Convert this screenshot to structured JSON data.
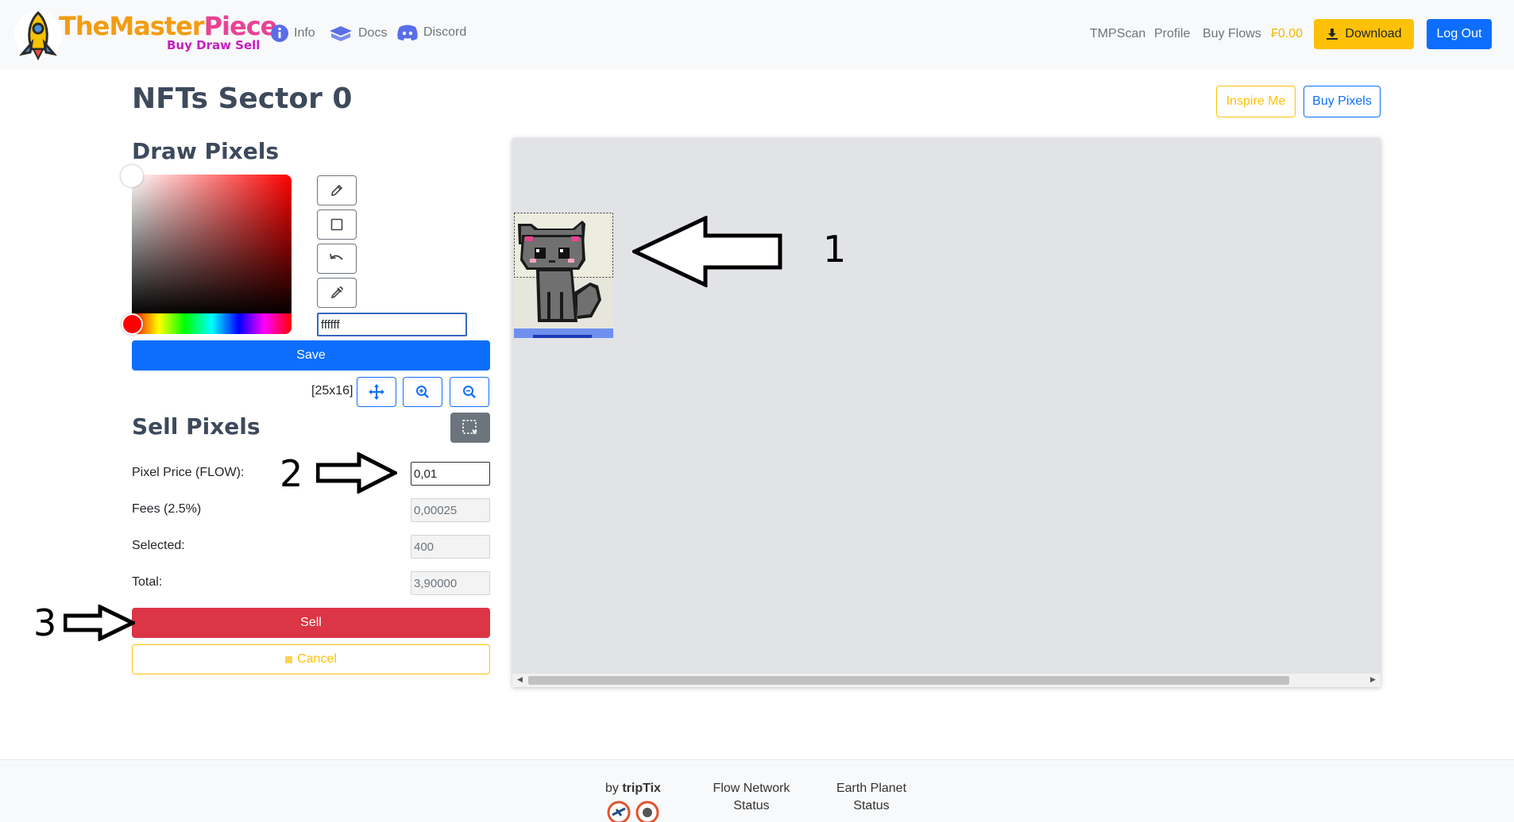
{
  "navbar": {
    "brand_part1": "TheMaster",
    "brand_part2": "Piece",
    "brand_tagline": "Buy Draw Sell",
    "links": [
      {
        "label": "Info",
        "icon": "info-icon"
      },
      {
        "label": "Docs",
        "icon": "docs-icon"
      },
      {
        "label": "Discord",
        "icon": "discord-icon"
      }
    ],
    "right_links": [
      "TMPScan",
      "Profile",
      "Buy Flows"
    ],
    "balance": "₣0.00",
    "download_label": "Download",
    "logout_label": "Log Out"
  },
  "page": {
    "title": "NFTs Sector 0",
    "inspire_label": "Inspire Me",
    "buy_pixels_label": "Buy Pixels"
  },
  "draw": {
    "heading": "Draw Pixels",
    "tools": [
      "pencil-icon",
      "square-icon",
      "undo-icon",
      "eyedropper-icon"
    ],
    "hex_value": "ffffff",
    "save_label": "Save",
    "dims": "[25x16]",
    "view_buttons": [
      "move-icon",
      "zoom-in-icon",
      "zoom-out-icon"
    ],
    "color_hue": "#ff0000"
  },
  "sell": {
    "heading": "Sell Pixels",
    "price_label": "Pixel Price (FLOW):",
    "price_value": "0,01",
    "fees_label": "Fees (2.5%)",
    "fees_value": "0,00025",
    "selected_label": "Selected:",
    "selected_value": "400",
    "total_label": "Total:",
    "total_value": "3,90000",
    "sell_label": "Sell",
    "cancel_label": "Cancel"
  },
  "annotations": [
    "1",
    "2",
    "3"
  ],
  "footer": {
    "by": "by ",
    "by_brand": "tripTix",
    "flow_line1": "Flow Network",
    "flow_line2": "Status",
    "earth_line1": "Earth Planet",
    "earth_line2": "Status"
  },
  "colors": {
    "primary": "#0d6efd",
    "warning": "#ffc107",
    "danger": "#dc3545",
    "secondary": "#6c757d"
  }
}
